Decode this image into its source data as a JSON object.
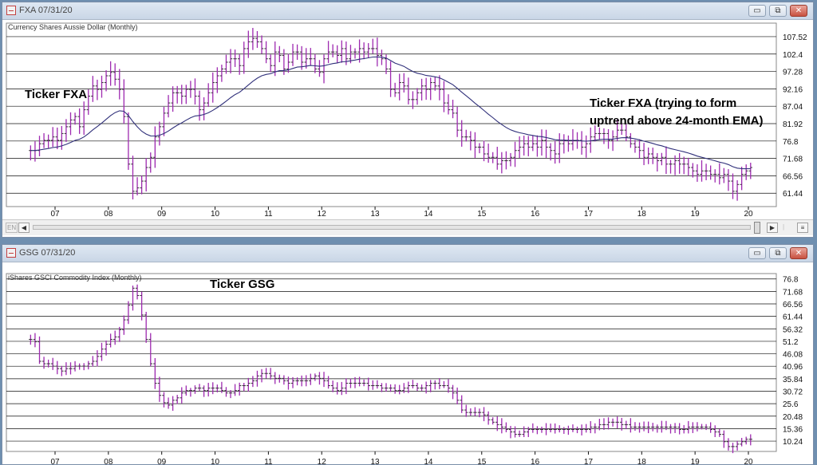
{
  "windows": [
    {
      "title": "FXA 07/31/20",
      "subtitle": "Currency Shares Aussie Dollar (Monthly)",
      "annotations": [
        "Ticker FXA",
        "Ticker FXA (trying to form",
        "uptrend above 24-month EMA)"
      ],
      "controls": {
        "minimize": "▭",
        "restore": "⧉",
        "close": "✕"
      }
    },
    {
      "title": "GSG 07/31/20",
      "subtitle": "iShares GSCI Commodity Index (Monthly)",
      "annotations": [
        "Ticker GSG"
      ],
      "controls": {
        "minimize": "▭",
        "restore": "⧉",
        "close": "✕"
      }
    }
  ],
  "scrollbar": {
    "en_label": "EN",
    "left_arrow": "◀",
    "right_arrow": "▶"
  },
  "chart_data": [
    {
      "type": "ohlc",
      "title": "Currency Shares Aussie Dollar (Monthly)",
      "ticker": "FXA",
      "x_start_year": 2006.5,
      "x_end_year": 2020.6,
      "x_tick_labels": [
        "07",
        "08",
        "09",
        "10",
        "11",
        "12",
        "13",
        "14",
        "15",
        "16",
        "17",
        "18",
        "19",
        "20"
      ],
      "y_tick_labels": [
        "107.52",
        "102.4",
        "97.28",
        "92.16",
        "87.04",
        "81.92",
        "76.8",
        "71.68",
        "66.56",
        "61.44"
      ],
      "ylim": [
        57.5,
        111.5
      ],
      "grid": true,
      "bar_color": "#9e2ab0",
      "ema_color": "#30307a",
      "ema_label": "24-month EMA",
      "monthly_close": [
        74,
        74,
        76,
        77,
        77,
        78,
        77,
        79,
        81,
        83,
        84,
        81,
        86,
        90,
        93,
        92,
        94,
        96,
        97,
        95,
        92,
        84,
        70,
        62,
        63,
        65,
        69,
        72,
        78,
        81,
        85,
        88,
        91,
        91,
        90,
        92,
        92,
        90,
        86,
        88,
        91,
        94,
        96,
        98,
        100,
        101,
        101,
        99,
        104,
        106,
        107,
        106,
        104,
        101,
        99,
        103,
        102,
        98,
        100,
        103,
        103,
        100,
        101,
        101,
        98,
        97,
        101,
        103,
        103,
        102,
        104,
        101,
        103,
        103,
        104,
        103,
        104,
        104,
        102,
        101,
        98,
        92,
        91,
        94,
        93,
        89,
        89,
        91,
        93,
        92,
        94,
        93,
        92,
        88,
        86,
        85,
        80,
        78,
        78,
        77,
        75,
        75,
        73,
        72,
        72,
        70,
        71,
        71,
        72,
        74,
        75,
        76,
        75,
        76,
        75,
        77,
        75,
        74,
        73,
        76,
        77,
        76,
        77,
        77,
        75,
        76,
        78,
        79,
        79,
        79,
        77,
        78,
        80,
        80,
        78,
        76,
        75,
        74,
        72,
        73,
        72,
        71,
        72,
        70,
        70,
        71,
        70,
        70,
        69,
        68,
        67,
        68,
        68,
        67,
        67,
        66,
        67,
        65,
        62,
        64,
        67,
        68,
        69
      ]
    },
    {
      "type": "ohlc",
      "title": "iShares GSCI Commodity Index (Monthly)",
      "ticker": "GSG",
      "x_start_year": 2006.5,
      "x_end_year": 2020.6,
      "x_tick_labels": [
        "07",
        "08",
        "09",
        "10",
        "11",
        "12",
        "13",
        "14",
        "15",
        "16",
        "17",
        "18",
        "19",
        "20"
      ],
      "y_tick_labels": [
        "76.8",
        "71.68",
        "66.56",
        "61.44",
        "56.32",
        "51.2",
        "46.08",
        "40.96",
        "35.84",
        "30.72",
        "25.6",
        "20.48",
        "15.36",
        "10.24"
      ],
      "ylim": [
        6,
        79
      ],
      "grid": true,
      "bar_color": "#9e2ab0",
      "monthly_close": [
        52,
        51,
        43,
        42,
        42,
        41,
        40,
        39,
        40,
        40,
        41,
        41,
        41,
        42,
        43,
        45,
        48,
        50,
        52,
        53,
        56,
        60,
        66,
        73,
        70,
        62,
        52,
        42,
        34,
        29,
        26,
        25,
        27,
        28,
        30,
        31,
        31,
        32,
        32,
        31,
        32,
        32,
        32,
        31,
        30,
        30,
        31,
        33,
        33,
        34,
        35,
        37,
        38,
        38,
        37,
        36,
        36,
        35,
        34,
        35,
        35,
        35,
        35,
        36,
        37,
        36,
        35,
        33,
        32,
        31,
        32,
        34,
        34,
        34,
        34,
        34,
        33,
        33,
        33,
        32,
        32,
        32,
        31,
        31,
        32,
        33,
        33,
        32,
        32,
        33,
        34,
        34,
        33,
        33,
        32,
        30,
        27,
        23,
        22,
        22,
        22,
        22,
        21,
        19,
        18,
        17,
        16,
        15,
        14,
        13,
        13,
        14,
        15,
        15,
        15,
        15,
        15,
        15,
        15,
        15,
        15,
        15,
        15,
        15,
        15,
        15,
        16,
        16,
        17,
        17,
        18,
        18,
        18,
        17,
        17,
        16,
        16,
        16,
        16,
        16,
        16,
        16,
        16,
        16,
        16,
        16,
        15,
        15,
        16,
        16,
        16,
        16,
        16,
        15,
        14,
        13,
        10,
        8,
        8,
        9,
        10,
        11,
        11
      ]
    }
  ]
}
